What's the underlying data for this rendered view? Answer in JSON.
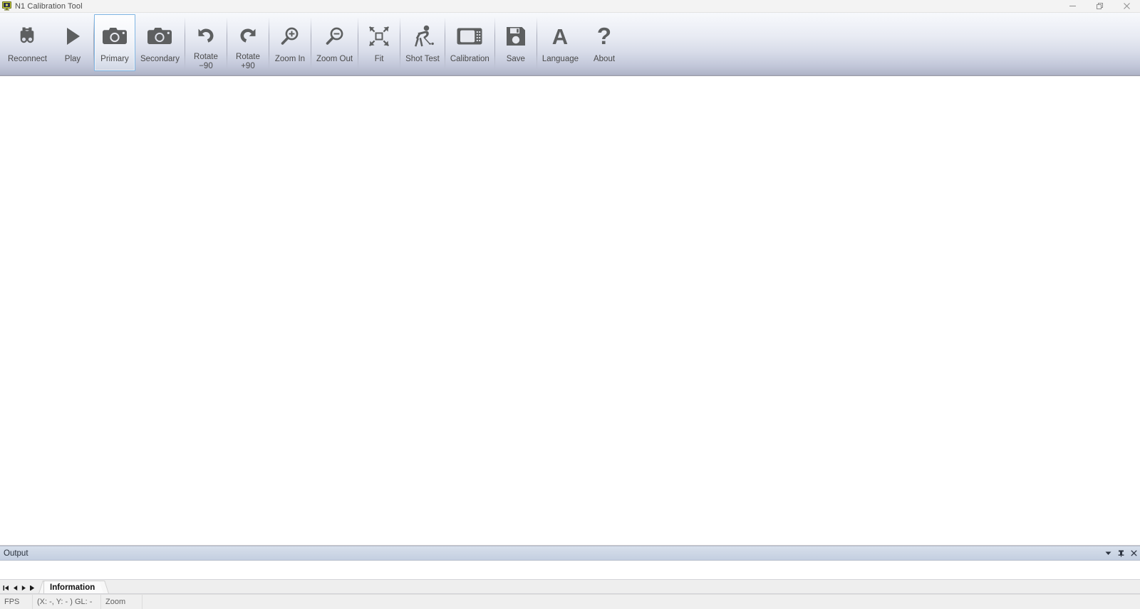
{
  "window": {
    "title": "N1 Calibration Tool",
    "icon": "monitor-icon",
    "controls": {
      "minimize": "minimize-icon",
      "restore": "restore-icon",
      "close": "close-icon"
    }
  },
  "toolbar": {
    "buttons": [
      {
        "id": "reconnect",
        "label": "Reconnect",
        "icon": "binoculars-icon",
        "selected": false,
        "separator_after": false
      },
      {
        "id": "play",
        "label": "Play",
        "icon": "play-icon",
        "selected": false,
        "separator_after": true
      },
      {
        "id": "primary",
        "label": "Primary",
        "icon": "camera-icon",
        "selected": true,
        "separator_after": false
      },
      {
        "id": "secondary",
        "label": "Secondary",
        "icon": "camera-icon",
        "selected": false,
        "separator_after": true
      },
      {
        "id": "rotate-m90",
        "label": "Rotate\n−90",
        "icon": "rotate-left-icon",
        "selected": false,
        "separator_after": true
      },
      {
        "id": "rotate-p90",
        "label": "Rotate\n+90",
        "icon": "rotate-right-icon",
        "selected": false,
        "separator_after": true
      },
      {
        "id": "zoom-in",
        "label": "Zoom In",
        "icon": "magnifier-plus-icon",
        "selected": false,
        "separator_after": true
      },
      {
        "id": "zoom-out",
        "label": "Zoom Out",
        "icon": "magnifier-minus-icon",
        "selected": false,
        "separator_after": true
      },
      {
        "id": "fit",
        "label": "Fit",
        "icon": "fit-screen-icon",
        "selected": false,
        "separator_after": true
      },
      {
        "id": "shot-test",
        "label": "Shot Test",
        "icon": "golfer-icon",
        "selected": false,
        "separator_after": true
      },
      {
        "id": "calibration",
        "label": "Calibration",
        "icon": "monitor-grid-icon",
        "selected": false,
        "separator_after": true
      },
      {
        "id": "save",
        "label": "Save",
        "icon": "floppy-disk-icon",
        "selected": false,
        "separator_after": true
      },
      {
        "id": "language",
        "label": "Language",
        "icon": "letter-a-icon",
        "selected": false,
        "separator_after": false
      },
      {
        "id": "about",
        "label": "About",
        "icon": "question-mark-icon",
        "selected": false,
        "separator_after": false
      }
    ]
  },
  "canvas": {
    "content": ""
  },
  "output_panel": {
    "title": "Output",
    "content": "",
    "tools": {
      "dropdown": "chevron-down-icon",
      "pin": "pin-icon",
      "close": "close-icon"
    }
  },
  "tabstrip": {
    "nav": {
      "first": "nav-first-icon",
      "prev": "nav-prev-icon",
      "next": "nav-next-icon",
      "last": "nav-last-icon"
    },
    "tabs": [
      {
        "id": "information",
        "label": "Information",
        "active": true
      }
    ]
  },
  "statusbar": {
    "fps": "FPS",
    "coordinates": "(X: -, Y: - ) GL: -",
    "zoom": "Zoom",
    "extra": ""
  },
  "colors": {
    "toolbar_top": "#f7f9fc",
    "toolbar_bottom": "#a9aec1",
    "selection_border": "#7eb4e2",
    "output_header": "#ccd6e5",
    "icon_gray": "#5d5f60",
    "canvas": "#ffffff"
  }
}
